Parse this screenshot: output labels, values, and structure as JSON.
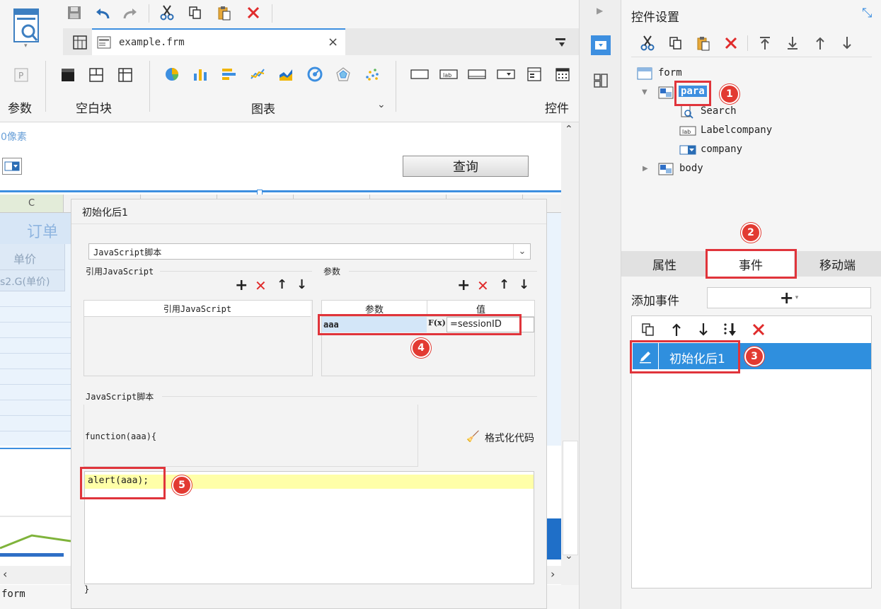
{
  "app": {
    "tab_title": "example.frm"
  },
  "toolbar": {
    "groups": {
      "param_label": "参数",
      "blank_label": "空白块",
      "chart_label": "图表",
      "control_label": "控件"
    }
  },
  "canvas": {
    "pixel_hint": "0像素",
    "query_button": "查询",
    "col_header": "C",
    "title_fragment": "订单",
    "unit_price_label": "单价",
    "formula_fragment": "s2.G(单价)",
    "status_bar": "form"
  },
  "dialog": {
    "title": "初始化后1",
    "script_type": "JavaScript脚本",
    "ref_js_section": "引用JavaScript",
    "param_section": "参数",
    "ref_js_column": "引用JavaScript",
    "param_columns": [
      "参数",
      "值"
    ],
    "param_rows": [
      {
        "name": "aaa",
        "value": "=sessionID"
      }
    ],
    "fx_label": "F(x)",
    "script_section": "JavaScript脚本",
    "function_header": "function(aaa){",
    "format_code": "格式化代码",
    "code_line": "alert(aaa);",
    "closing_brace": "}"
  },
  "right_panel": {
    "title": "控件设置",
    "tree": [
      {
        "label": "form",
        "icon": "form-icon"
      },
      {
        "label": "para",
        "icon": "para-icon"
      },
      {
        "label": "Search",
        "icon": "search-widget-icon"
      },
      {
        "label": "Labelcompany",
        "icon": "label-widget-icon"
      },
      {
        "label": "company",
        "icon": "combo-widget-icon"
      },
      {
        "label": "body",
        "icon": "body-icon"
      }
    ],
    "tabs": [
      "属性",
      "事件",
      "移动端"
    ],
    "add_event_label": "添加事件",
    "event_item": "初始化后1"
  },
  "callouts": [
    "1",
    "2",
    "3",
    "4",
    "5"
  ],
  "colors": {
    "accent_blue": "#3d8fe0",
    "highlight_red": "#e0343b",
    "code_highlight": "#ffffa8",
    "selection_blue": "#2f8fde"
  }
}
